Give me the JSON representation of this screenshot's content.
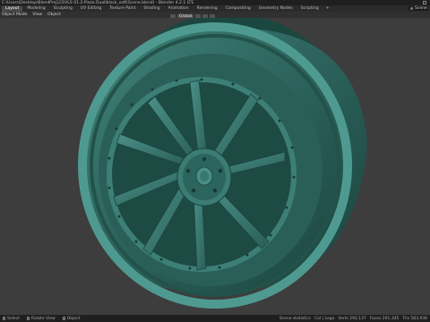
{
  "window": {
    "title": "C:\\Users\\Desktop\\BlendProj\\23\\VLS 01.2-Pieza Duallblock_soft(Scene.blend) - Blender 4.2.1 LTS"
  },
  "workspaces": {
    "tabs": [
      "Layout",
      "Modeling",
      "Sculpting",
      "UV Editing",
      "Texture Paint",
      "Shading",
      "Animation",
      "Rendering",
      "Compositing",
      "Geometry Nodes",
      "Scripting"
    ],
    "active": "Layout",
    "add_label": "+"
  },
  "header": {
    "menus": [
      "Object Mode",
      "View",
      "Object"
    ],
    "transform_orientation": "Global"
  },
  "scene": {
    "label": "Scene"
  },
  "status": {
    "hints": [
      "Select",
      "Rotate View",
      "Object"
    ],
    "stats": [
      "Scene statistics",
      "Col | Logo",
      "Verts 292,137",
      "Faces 291,345",
      "Tris 583,936"
    ]
  },
  "colors": {
    "viewport_bg": "#3d3d3d",
    "model_base": "#2f6b63",
    "model_light": "#4a8f86",
    "model_dark": "#1c4640",
    "active_tab": "#4a4a4a"
  },
  "icons": [
    "mouse-icon",
    "scene-icon",
    "window-icon"
  ]
}
